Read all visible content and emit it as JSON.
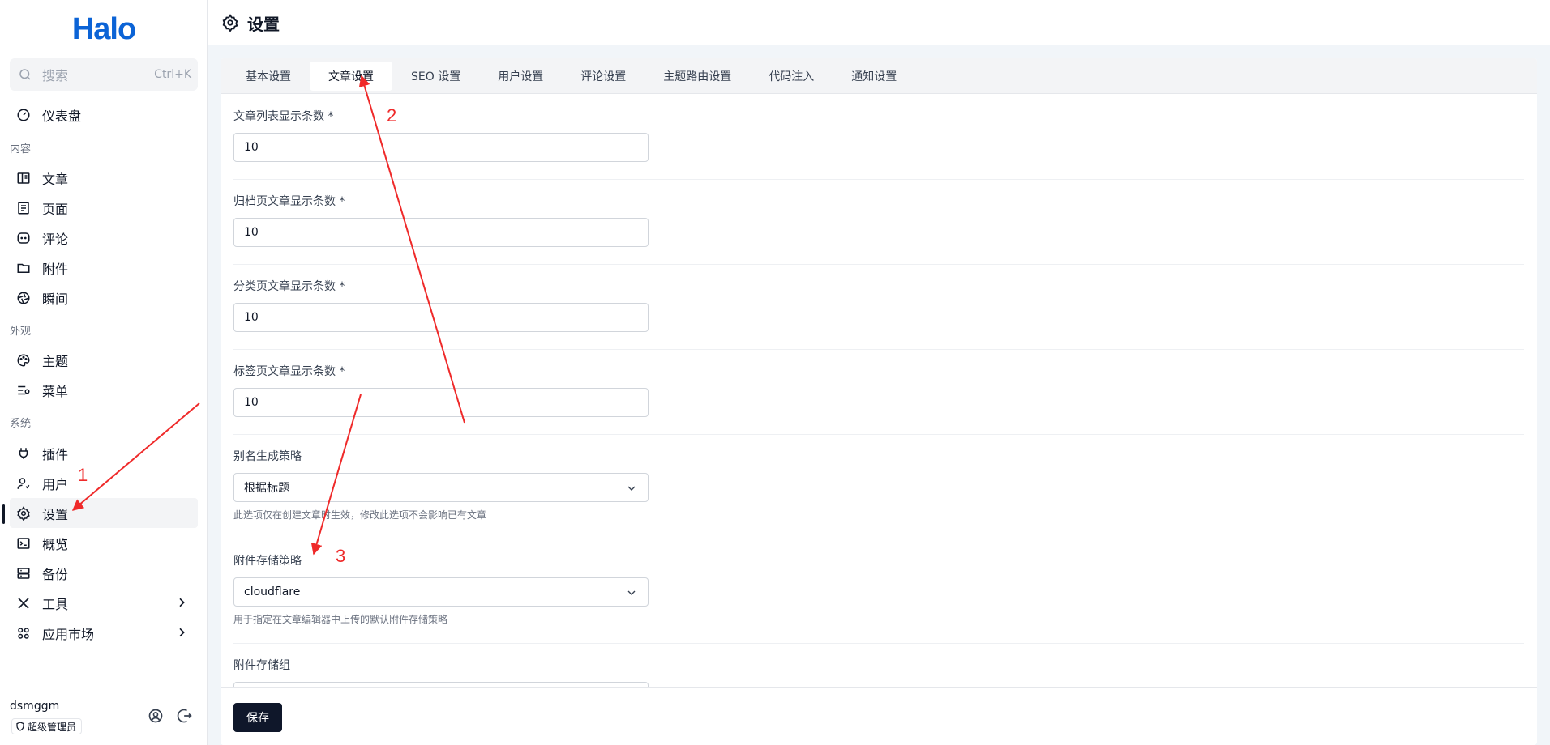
{
  "brand": {
    "logo_text": "Halo",
    "accent": "#0b63d6"
  },
  "search": {
    "placeholder": "搜索",
    "shortcut": "Ctrl+K"
  },
  "sidebar": {
    "dashboard": "仪表盘",
    "group_content": "内容",
    "posts": "文章",
    "pages": "页面",
    "comments": "评论",
    "attachments": "附件",
    "moments": "瞬间",
    "group_appearance": "外观",
    "themes": "主题",
    "menus": "菜单",
    "group_system": "系统",
    "plugins": "插件",
    "users": "用户",
    "settings": "设置",
    "overview": "概览",
    "backup": "备份",
    "tools": "工具",
    "app_market": "应用市场"
  },
  "user": {
    "name": "dsmggm",
    "role": "超级管理员"
  },
  "header": {
    "title": "设置"
  },
  "tabs": [
    "基本设置",
    "文章设置",
    "SEO 设置",
    "用户设置",
    "评论设置",
    "主题路由设置",
    "代码注入",
    "通知设置"
  ],
  "active_tab": "文章设置",
  "form": {
    "post_list_size": {
      "label": "文章列表显示条数 *",
      "value": "10"
    },
    "archive_size": {
      "label": "归档页文章显示条数 *",
      "value": "10"
    },
    "category_size": {
      "label": "分类页文章显示条数 *",
      "value": "10"
    },
    "tag_size": {
      "label": "标签页文章显示条数 *",
      "value": "10"
    },
    "slug_strategy": {
      "label": "别名生成策略",
      "value": "根据标题",
      "help": "此选项仅在创建文章时生效，修改此选项不会影响已有文章"
    },
    "attachment_policy": {
      "label": "附件存储策略",
      "value": "cloudflare",
      "help": "用于指定在文章编辑器中上传的默认附件存储策略"
    },
    "attachment_group": {
      "label": "附件存储组"
    }
  },
  "footer": {
    "save": "保存"
  },
  "annotations": {
    "n1": "1",
    "n2": "2",
    "n3": "3",
    "color": "#ef2a2a"
  }
}
